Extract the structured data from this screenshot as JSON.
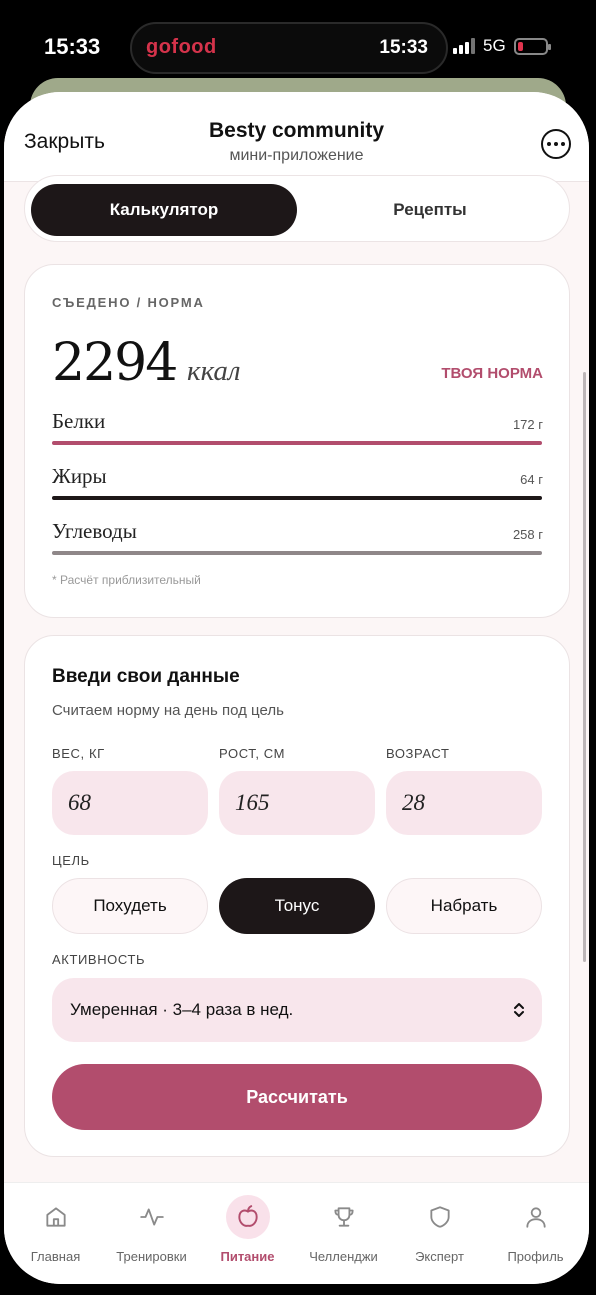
{
  "status_bar": {
    "time": "15:33",
    "island_brand": "gofood",
    "island_time": "15:33",
    "network": "5G",
    "battery_level_percent": 20
  },
  "header": {
    "close_label": "Закрыть",
    "title": "Besty community",
    "subtitle": "мини-приложение",
    "more_icon": "ellipsis-circle-icon"
  },
  "tabs": {
    "items": [
      "Калькулятор",
      "Рецепты"
    ],
    "active": "Калькулятор"
  },
  "summary": {
    "eyebrow": "СЪЕДЕНО / НОРМА",
    "kcal_value": "2294",
    "kcal_unit": "ккал",
    "norm_link": "ТВОЯ НОРМА",
    "macros": [
      {
        "name": "Белки",
        "value": "172 г",
        "color": "#b24d6d"
      },
      {
        "name": "Жиры",
        "value": "64 г",
        "color": "#1d1718"
      },
      {
        "name": "Углеводы",
        "value": "258 г",
        "color": "#8f8789"
      }
    ],
    "note": "* Расчёт приблизительный"
  },
  "form": {
    "title": "Введи свои данные",
    "subtitle": "Считаем норму на день под цель",
    "weight": {
      "label": "ВЕС, КГ",
      "value": "68"
    },
    "height": {
      "label": "РОСТ, СМ",
      "value": "165"
    },
    "age": {
      "label": "ВОЗРАСТ",
      "value": "28"
    },
    "goal": {
      "label": "ЦЕЛЬ",
      "options": [
        "Похудеть",
        "Тонус",
        "Набрать"
      ],
      "selected": "Тонус"
    },
    "activity": {
      "label": "АКТИВНОСТЬ",
      "value": "Умеренная · 3–4 раза в нед."
    },
    "submit_label": "Рассчитать"
  },
  "bottom_nav": {
    "active": "Питание",
    "items": [
      {
        "label": "Главная",
        "icon": "home-icon"
      },
      {
        "label": "Тренировки",
        "icon": "activity-pulse-icon"
      },
      {
        "label": "Питание",
        "icon": "apple-icon"
      },
      {
        "label": "Челленджи",
        "icon": "trophy-icon"
      },
      {
        "label": "Эксперт",
        "icon": "shield-icon"
      },
      {
        "label": "Профиль",
        "icon": "user-icon"
      }
    ]
  },
  "colors": {
    "accent": "#b24d6d",
    "dark": "#1d1718",
    "input_bg": "#f8e6ec",
    "page_bg": "#fcf6f6"
  }
}
